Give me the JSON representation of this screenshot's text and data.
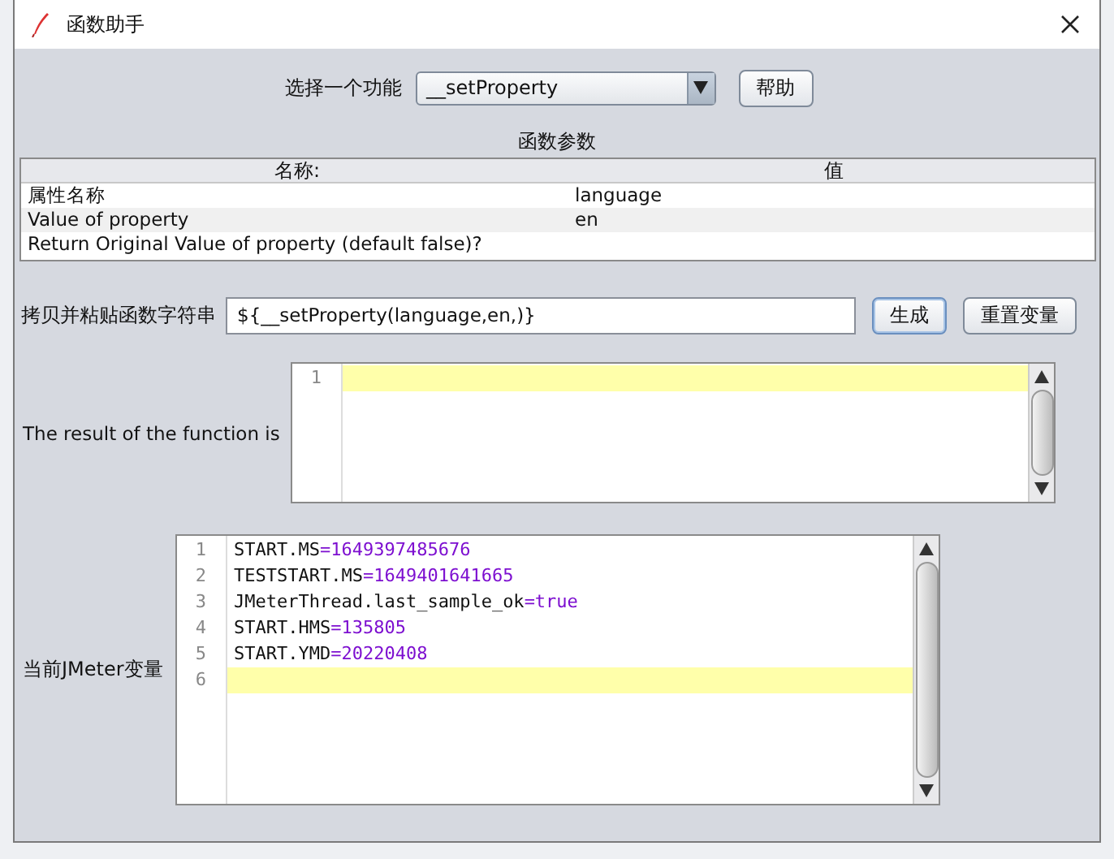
{
  "window": {
    "title": "函数助手"
  },
  "function_select": {
    "label": "选择一个功能",
    "value": "__setProperty",
    "help_button": "帮助"
  },
  "parameters": {
    "title": "函数参数",
    "columns": [
      "名称:",
      "值"
    ],
    "rows": [
      {
        "name": "属性名称",
        "value": "language"
      },
      {
        "name": "Value of property",
        "value": "en"
      },
      {
        "name": "Return Original Value of property (default false)?",
        "value": ""
      }
    ]
  },
  "copy_row": {
    "label": "拷贝并粘贴函数字符串",
    "value": "${__setProperty(language,en,)}",
    "generate_button": "生成",
    "reset_button": "重置变量"
  },
  "result": {
    "label": "The result of the function is",
    "lines": [
      {
        "number": "1",
        "current": true
      }
    ]
  },
  "variables": {
    "label": "当前JMeter变量",
    "lines": [
      {
        "number": "1",
        "key": "START.MS",
        "sep": "=",
        "value": "1649397485676",
        "current": false
      },
      {
        "number": "2",
        "key": "TESTSTART.MS",
        "sep": "=",
        "value": "1649401641665",
        "current": false
      },
      {
        "number": "3",
        "key": "JMeterThread.last_sample_ok",
        "sep": "=",
        "value": "true",
        "current": false
      },
      {
        "number": "4",
        "key": "START.HMS",
        "sep": "=",
        "value": "135805",
        "current": false
      },
      {
        "number": "5",
        "key": "START.YMD",
        "sep": "=",
        "value": "20220408",
        "current": false
      },
      {
        "number": "6",
        "current": true
      }
    ]
  }
}
